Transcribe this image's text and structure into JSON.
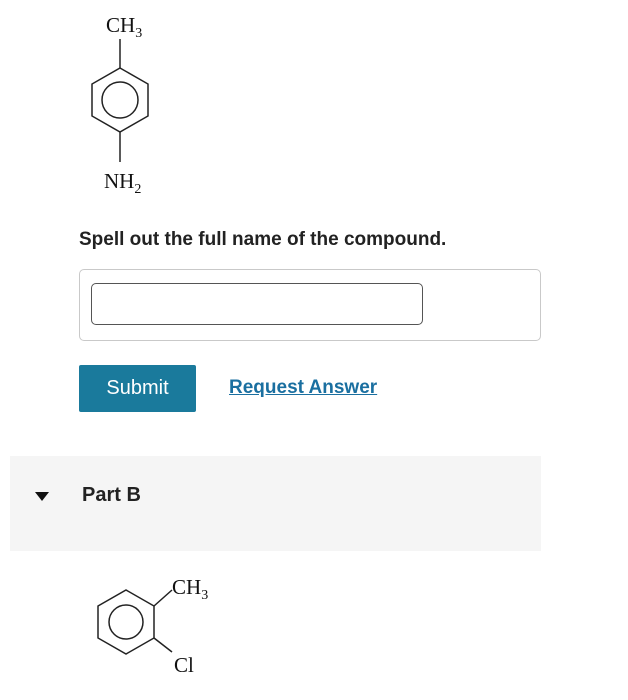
{
  "part_a": {
    "molecule": {
      "top_group": "CH",
      "top_sub": "3",
      "bottom_group": "NH",
      "bottom_sub": "2"
    },
    "prompt": "Spell out the full name of the compound.",
    "answer": {
      "value": "",
      "placeholder": ""
    },
    "submit_label": "Submit",
    "request_answer_label": "Request Answer"
  },
  "part_b": {
    "title": "Part B",
    "caret_icon": "caret-down-icon",
    "molecule": {
      "group_1": "CH",
      "group_1_sub": "3",
      "group_2": "Cl"
    }
  },
  "colors": {
    "submit_bg": "#1a7a9c",
    "link": "#1a6fa0",
    "panel_bg": "#f5f5f5"
  }
}
